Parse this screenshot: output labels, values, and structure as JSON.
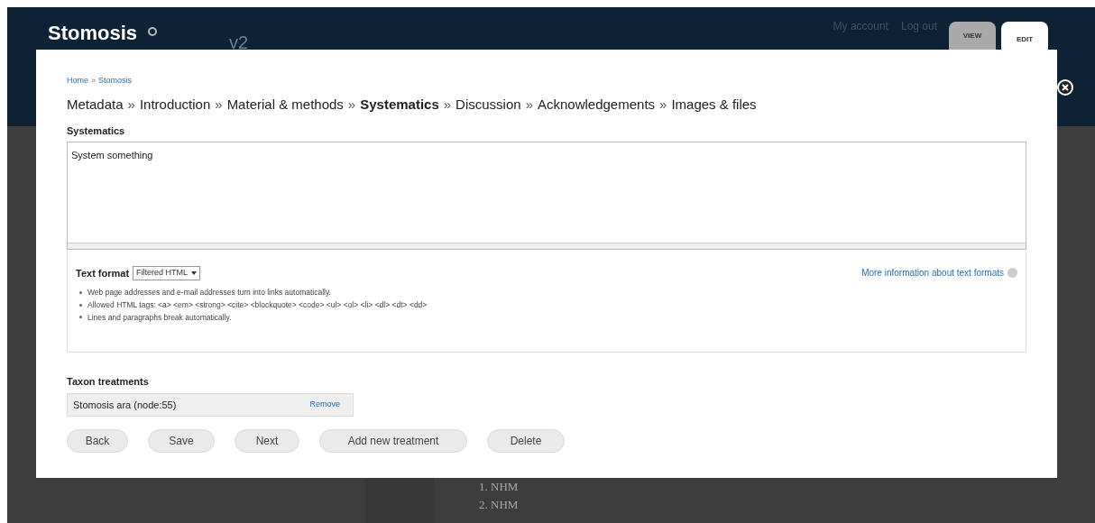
{
  "site": {
    "title": "Stomosis",
    "version_mark": "v2",
    "user_links": [
      "My account",
      "Log out"
    ]
  },
  "tabs": [
    {
      "label": "VIEW",
      "selected": false
    },
    {
      "label": "EDIT",
      "selected": true
    }
  ],
  "background_list": [
    "1. NHM",
    "2. NHM"
  ],
  "dialog": {
    "separator": "»",
    "breadcrumb": [
      "Home",
      "Stomosis"
    ],
    "steps": [
      {
        "label": "Metadata",
        "selected": false
      },
      {
        "label": "Introduction",
        "selected": false
      },
      {
        "label": "Material & methods",
        "selected": false
      },
      {
        "label": "Systematics",
        "selected": true
      },
      {
        "label": "Discussion",
        "selected": false
      },
      {
        "label": "Acknowledgements",
        "selected": false
      },
      {
        "label": "Images & files",
        "selected": false
      }
    ],
    "field_label": "Systematics",
    "field_value": "System something",
    "text_format": {
      "label": "Text format",
      "value": "Filtered HTML",
      "help_link": "More information about text formats",
      "tips": [
        "Web page addresses and e-mail addresses turn into links automatically.",
        "Allowed HTML tags: <a> <em> <strong> <cite> <blockquote> <code> <ul> <ol> <li> <dl> <dt> <dd>",
        "Lines and paragraphs break automatically."
      ]
    },
    "treatments_label": "Taxon treatments",
    "treatments": [
      {
        "name": "Stomosis ara (node:55)",
        "action": "Remove"
      }
    ],
    "buttons": [
      "Back",
      "Save",
      "Next",
      "Add new treatment",
      "Delete"
    ]
  }
}
